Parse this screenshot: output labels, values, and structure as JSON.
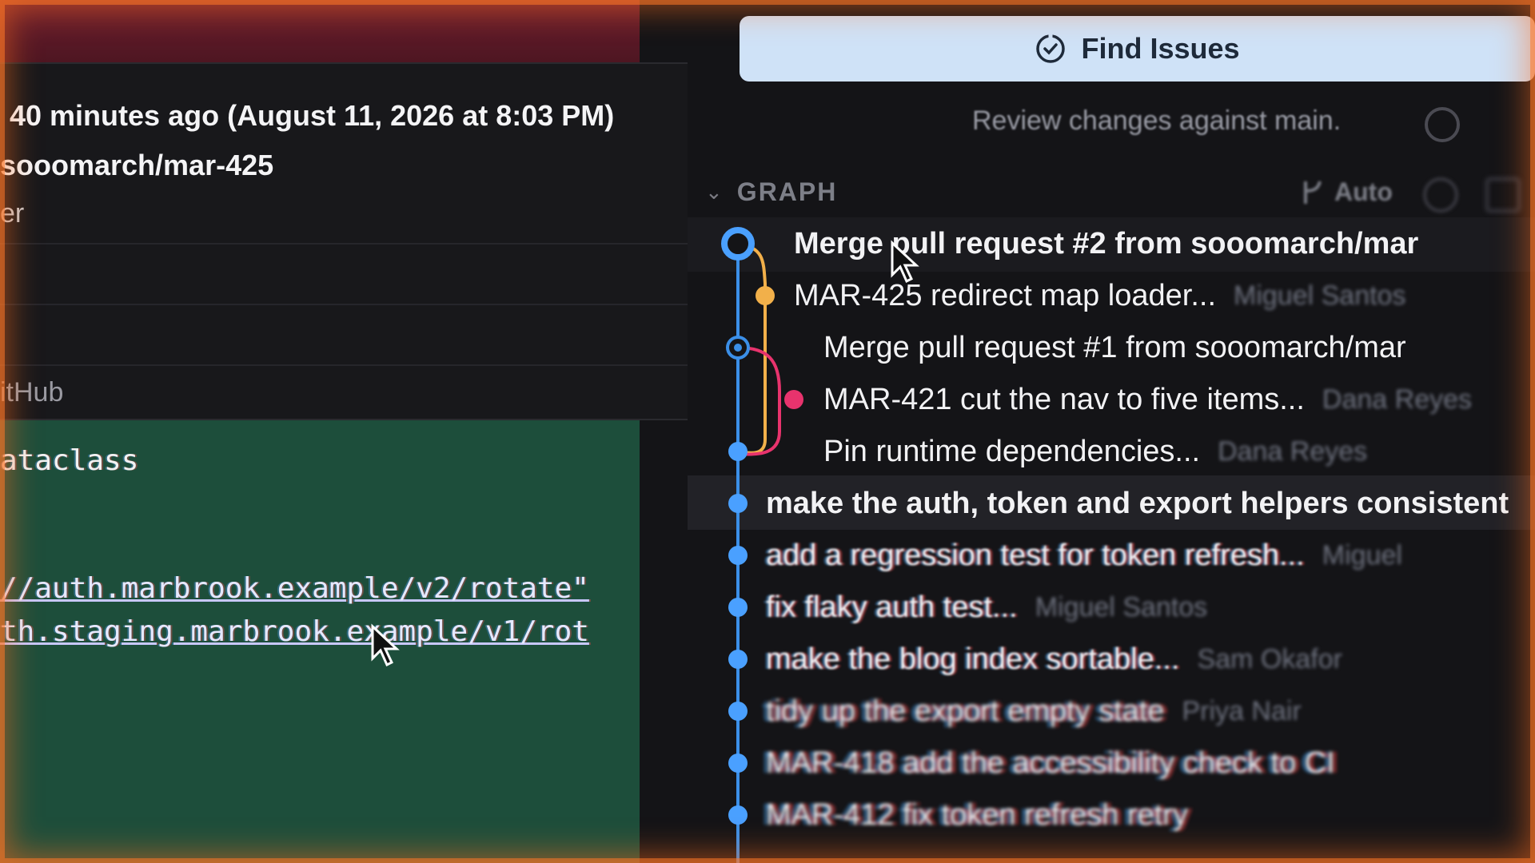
{
  "tooltip": {
    "time": "40 minutes ago (August 11, 2026 at 8:03 PM)",
    "branch": "sooomarch/mar-425",
    "line3": "er",
    "source": "itHub"
  },
  "editor": {
    "lines": [
      "ataclass",
      "//auth.marbrook.example/v2/rotate\"",
      "th.staging.marbrook.example/v1/rot"
    ]
  },
  "panel": {
    "find_issues_label": "Find Issues",
    "review_text": "Review changes against main.",
    "graph_title": "GRAPH",
    "auto_label": "Auto"
  },
  "commits": [
    {
      "message": "Merge pull request #2 from sooomarch/mar",
      "author": ""
    },
    {
      "message": "MAR-425 redirect map loader...",
      "author": "Miguel Santos"
    },
    {
      "message": "Merge pull request #1 from sooomarch/mar",
      "author": ""
    },
    {
      "message": "MAR-421 cut the nav to five items...",
      "author": "Dana Reyes"
    },
    {
      "message": "Pin runtime dependencies...",
      "author": "Dana Reyes"
    },
    {
      "message": "make the auth, token and export helpers consistent",
      "author": ""
    },
    {
      "message": "add a regression test for token refresh...",
      "author": "Miguel"
    },
    {
      "message": "fix flaky auth test...",
      "author": "Miguel Santos"
    },
    {
      "message": "make the blog index sortable...",
      "author": "Sam Okafor"
    },
    {
      "message": "tidy up the export empty state",
      "author": "Priya Nair"
    },
    {
      "message": "MAR-418 add the accessibility check to CI",
      "author": ""
    },
    {
      "message": "MAR-412 fix token refresh retry",
      "author": ""
    }
  ],
  "colors": {
    "main_lane": "#3b8fe8",
    "branch_orange": "#f2b04a",
    "branch_pink": "#e8336d",
    "button_bg": "#cfe2f7",
    "editor_green": "#1d4e3b"
  },
  "icons": [
    "clock-check-icon",
    "help-icon",
    "chevron-down-icon",
    "branch-icon",
    "pointer-cursor-icon"
  ]
}
